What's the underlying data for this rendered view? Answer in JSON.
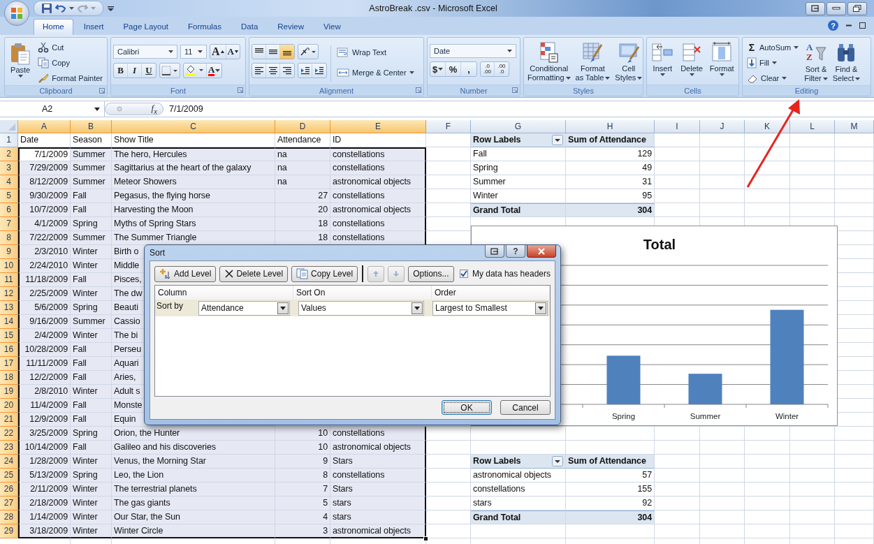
{
  "window": {
    "title": "AstroBreak .csv - Microsoft Excel",
    "help": "?"
  },
  "tabs": [
    {
      "label": "Home",
      "selected": true
    },
    {
      "label": "Insert",
      "selected": false
    },
    {
      "label": "Page Layout",
      "selected": false
    },
    {
      "label": "Formulas",
      "selected": false
    },
    {
      "label": "Data",
      "selected": false
    },
    {
      "label": "Review",
      "selected": false
    },
    {
      "label": "View",
      "selected": false
    }
  ],
  "ribbon": {
    "clipboard": {
      "label": "Clipboard",
      "paste": "Paste",
      "items": [
        "Cut",
        "Copy",
        "Format Painter"
      ]
    },
    "font": {
      "label": "Font",
      "font_name": "Calibri",
      "font_size": "11",
      "grow": "A",
      "shrink": "A",
      "styles": [
        "B",
        "I",
        "U"
      ],
      "font_color": "A"
    },
    "alignment": {
      "label": "Alignment",
      "vertical": [
        {
          "selected": false
        },
        {
          "selected": false
        },
        {
          "selected": true
        }
      ],
      "wrap": "Wrap Text",
      "merge": "Merge & Center"
    },
    "number": {
      "label": "Number",
      "format": "Date",
      "symbols": [
        "$",
        "%",
        ","
      ],
      "decimals": [
        {
          "top": ".0",
          "bottom": ".00"
        },
        {
          "top": ".00",
          "bottom": ".0"
        }
      ]
    },
    "styles": {
      "label": "Styles",
      "buttons": [
        {
          "lines": [
            "Conditional",
            "Formatting"
          ]
        },
        {
          "lines": [
            "Format",
            "as Table"
          ]
        },
        {
          "lines": [
            "Cell",
            "Styles"
          ]
        }
      ]
    },
    "cells": {
      "label": "Cells",
      "buttons": [
        "Insert",
        "Delete",
        "Format"
      ]
    },
    "editing": {
      "label": "Editing",
      "autosum_symbol": "Σ",
      "small": [
        "AutoSum",
        "Fill",
        "Clear"
      ],
      "sort_letters": [
        "A",
        "Z"
      ],
      "big": [
        {
          "lines": [
            "Sort &",
            "Filter"
          ]
        },
        {
          "lines": [
            "Find &",
            "Select"
          ]
        }
      ]
    }
  },
  "formula_bar": {
    "name_box": "A2",
    "fx": "f$_{x}$",
    "value": "7/1/2009"
  },
  "sheet": {
    "columns": [
      {
        "letter": "A",
        "selected": true
      },
      {
        "letter": "B",
        "selected": true
      },
      {
        "letter": "C",
        "selected": true
      },
      {
        "letter": "D",
        "selected": true
      },
      {
        "letter": "E",
        "selected": true
      },
      {
        "letter": "F",
        "selected": false
      },
      {
        "letter": "G",
        "selected": false
      },
      {
        "letter": "H",
        "selected": false
      },
      {
        "letter": "I",
        "selected": false
      },
      {
        "letter": "J",
        "selected": false
      },
      {
        "letter": "K",
        "selected": false
      },
      {
        "letter": "L",
        "selected": false
      },
      {
        "letter": "M",
        "selected": false
      }
    ],
    "rows": [
      {
        "number": "1",
        "selected": false,
        "header": true,
        "data": [
          "Date",
          "Season",
          "Show Title",
          "Attendance",
          "ID"
        ],
        "pivot": {
          "kind": "header",
          "label": "Row Labels",
          "value": "Sum of Attendance"
        }
      },
      {
        "number": "2",
        "selected": true,
        "active": true,
        "attendance_is_text": true,
        "data": [
          "7/1/2009",
          "Summer",
          "The hero, Hercules",
          "na",
          "constellations"
        ],
        "pivot": {
          "kind": "item",
          "label": "Fall",
          "value": "129"
        }
      },
      {
        "number": "3",
        "selected": true,
        "attendance_is_text": true,
        "data": [
          "7/29/2009",
          "Summer",
          "Sagittarius at the heart of the galaxy",
          "na",
          "constellations"
        ],
        "pivot": {
          "kind": "item",
          "label": "Spring",
          "value": "49"
        }
      },
      {
        "number": "4",
        "selected": true,
        "attendance_is_text": true,
        "data": [
          "8/12/2009",
          "Summer",
          "Meteor Showers",
          "na",
          "astronomical objects"
        ],
        "pivot": {
          "kind": "item",
          "label": "Summer",
          "value": "31"
        }
      },
      {
        "number": "5",
        "selected": true,
        "data": [
          "9/30/2009",
          "Fall",
          "Pegasus, the flying horse",
          "27",
          "constellations"
        ],
        "pivot": {
          "kind": "item",
          "label": "Winter",
          "value": "95"
        }
      },
      {
        "number": "6",
        "selected": true,
        "data": [
          "10/7/2009",
          "Fall",
          "Harvesting the Moon",
          "20",
          "astronomical objects"
        ],
        "pivot": {
          "kind": "total",
          "label": "Grand Total",
          "value": "304"
        }
      },
      {
        "number": "7",
        "selected": true,
        "data": [
          "4/1/2009",
          "Spring",
          "Myths of Spring Stars",
          "18",
          "constellations"
        ]
      },
      {
        "number": "8",
        "selected": true,
        "data": [
          "7/22/2009",
          "Summer",
          "The Summer Triangle",
          "18",
          "constellations"
        ]
      },
      {
        "number": "9",
        "selected": true,
        "data": [
          "2/3/2010",
          "Winter",
          "Birth o"
        ]
      },
      {
        "number": "10",
        "selected": true,
        "data": [
          "2/24/2010",
          "Winter",
          "Middle"
        ]
      },
      {
        "number": "11",
        "selected": true,
        "data": [
          "11/18/2009",
          "Fall",
          "Pisces,"
        ]
      },
      {
        "number": "12",
        "selected": true,
        "data": [
          "2/25/2009",
          "Winter",
          "The dw"
        ]
      },
      {
        "number": "13",
        "selected": true,
        "data": [
          "5/6/2009",
          "Spring",
          "Beauti"
        ]
      },
      {
        "number": "14",
        "selected": true,
        "data": [
          "9/16/2009",
          "Summer",
          "Cassio"
        ]
      },
      {
        "number": "15",
        "selected": true,
        "data": [
          "2/4/2009",
          "Winter",
          "The bi"
        ]
      },
      {
        "number": "16",
        "selected": true,
        "data": [
          "10/28/2009",
          "Fall",
          "Perseu"
        ]
      },
      {
        "number": "17",
        "selected": true,
        "data": [
          "11/11/2009",
          "Fall",
          "Aquari"
        ]
      },
      {
        "number": "18",
        "selected": true,
        "data": [
          "12/2/2009",
          "Fall",
          "Aries,"
        ]
      },
      {
        "number": "19",
        "selected": true,
        "data": [
          "2/8/2010",
          "Winter",
          "Adult s"
        ]
      },
      {
        "number": "20",
        "selected": true,
        "data": [
          "11/4/2009",
          "Fall",
          "Monste"
        ]
      },
      {
        "number": "21",
        "selected": true,
        "data": [
          "12/9/2009",
          "Fall",
          "Equin"
        ]
      },
      {
        "number": "22",
        "selected": true,
        "data": [
          "3/25/2009",
          "Spring",
          "Orion, the Hunter",
          "10",
          "constellations"
        ]
      },
      {
        "number": "23",
        "selected": true,
        "data": [
          "10/14/2009",
          "Fall",
          "Galileo and his discoveries",
          "10",
          "astronomical objects"
        ]
      },
      {
        "number": "24",
        "selected": true,
        "data": [
          "1/28/2009",
          "Winter",
          "Venus, the Morning Star",
          "9",
          "Stars"
        ],
        "pivot": {
          "kind": "header",
          "label": "Row Labels",
          "value": "Sum of Attendance"
        }
      },
      {
        "number": "25",
        "selected": true,
        "data": [
          "5/13/2009",
          "Spring",
          "Leo, the Lion",
          "8",
          "constellations"
        ],
        "pivot": {
          "kind": "item",
          "label": "astronomical objects",
          "value": "57"
        }
      },
      {
        "number": "26",
        "selected": true,
        "data": [
          "2/11/2009",
          "Winter",
          "The terrestrial planets",
          "7",
          "Stars"
        ],
        "pivot": {
          "kind": "item",
          "label": "constellations",
          "value": "155"
        }
      },
      {
        "number": "27",
        "selected": true,
        "data": [
          "2/18/2009",
          "Winter",
          "The gas giants",
          "5",
          "stars"
        ],
        "pivot": {
          "kind": "item",
          "label": "stars",
          "value": "92"
        }
      },
      {
        "number": "28",
        "selected": true,
        "data": [
          "1/14/2009",
          "Winter",
          "Our Star, the Sun",
          "4",
          "stars"
        ],
        "pivot": {
          "kind": "total",
          "label": "Grand Total",
          "value": "304"
        }
      },
      {
        "number": "29",
        "selected": true,
        "data": [
          "3/18/2009",
          "Winter",
          "Winter Circle",
          "3",
          "astronomical objects"
        ]
      }
    ]
  },
  "chart": {
    "title": "Total",
    "categories": [
      "Spring",
      "Summer",
      "Winter"
    ]
  },
  "sort_dialog": {
    "title": "Sort",
    "help": "?",
    "toolbar": [
      {
        "label": "Add Level"
      },
      {
        "label": "Delete Level"
      },
      {
        "label": "Copy Level"
      }
    ],
    "options": "Options...",
    "headers_checkbox": {
      "label": "My data has headers",
      "checked": true
    },
    "columns": [
      "Column",
      "Sort On",
      "Order"
    ],
    "levels": [
      {
        "label": "Sort by",
        "column": "Attendance",
        "sort_on": "Values",
        "order": "Largest to Smallest"
      }
    ],
    "buttons": [
      {
        "label": "OK",
        "default": true
      },
      {
        "label": "Cancel",
        "default": false
      }
    ]
  }
}
